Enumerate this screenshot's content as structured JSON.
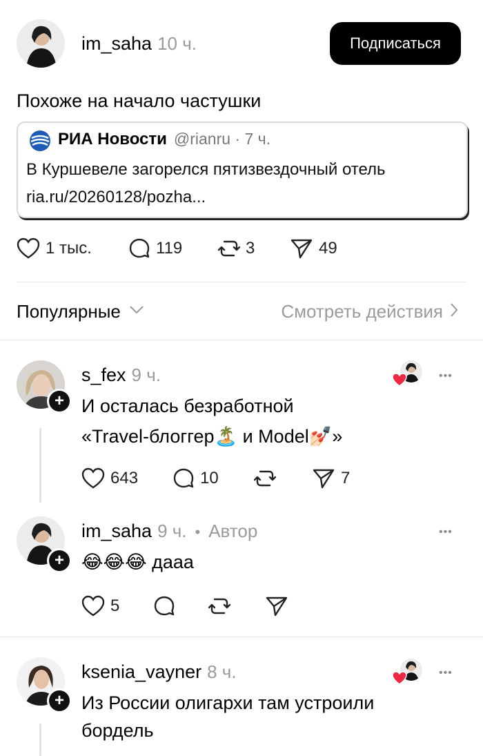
{
  "post": {
    "author": "im_saha",
    "time": "10 ч.",
    "follow_label": "Подписаться",
    "text": "Похоже на начало частушки",
    "quote": {
      "source_name": "РИА Новости",
      "handle": "@rianru · 7 ч.",
      "line1": "В Куршевеле загорелся пятизвездочный отель",
      "line2": "ria.ru/20260128/pozha..."
    },
    "actions": {
      "likes": "1 тыс.",
      "comments": "119",
      "reposts": "3",
      "shares": "49"
    }
  },
  "sort": {
    "label": "Популярные",
    "view_activity": "Смотреть действия"
  },
  "comments": [
    {
      "author": "s_fex",
      "time": "9 ч.",
      "text_line1": "И осталась безработной",
      "text_line2": "«Travel-блоггер🏝️ и Model💅🏻»",
      "likes": "643",
      "replies": "10",
      "reposts": "",
      "shares": "7"
    },
    {
      "author": "im_saha",
      "time": "9 ч.",
      "author_badge": "Автор",
      "text": "😂😂😂 дааа",
      "likes": "5",
      "replies": "",
      "reposts": "",
      "shares": ""
    },
    {
      "author": "ksenia_vayner",
      "time": "8 ч.",
      "text_line1": "Из России олигархи там устроили",
      "text_line2": "бордель"
    }
  ],
  "more_label": "•••",
  "plus_label": "+"
}
